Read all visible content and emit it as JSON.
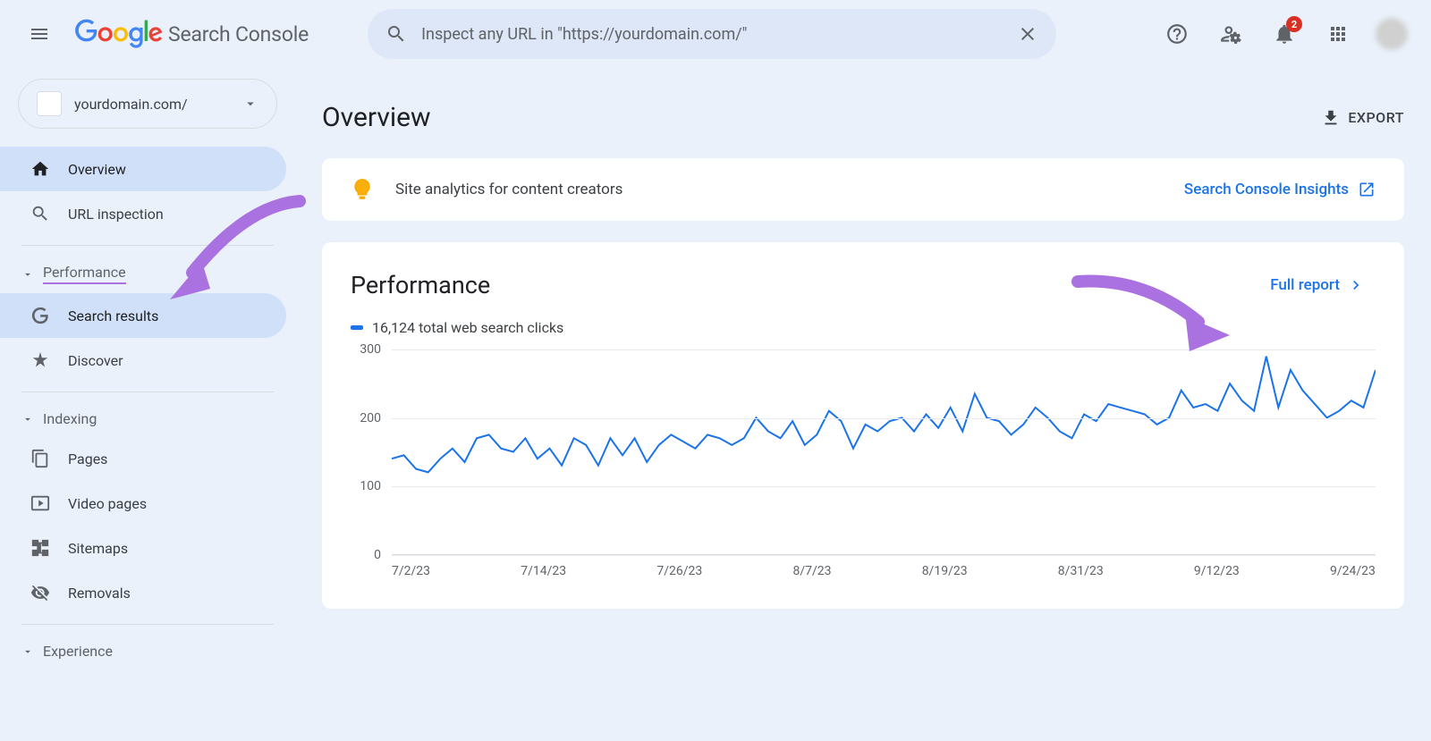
{
  "app": {
    "title": "Search Console"
  },
  "search": {
    "placeholder": "Inspect any URL in \"https://yourdomain.com/\""
  },
  "notifications": {
    "count": "2"
  },
  "property": {
    "domain": "yourdomain.com/"
  },
  "sidebar": {
    "overview": "Overview",
    "url_inspection": "URL inspection",
    "group_performance": "Performance",
    "search_results": "Search results",
    "discover": "Discover",
    "group_indexing": "Indexing",
    "pages": "Pages",
    "video_pages": "Video pages",
    "sitemaps": "Sitemaps",
    "removals": "Removals",
    "group_experience": "Experience"
  },
  "main": {
    "title": "Overview",
    "export": "EXPORT",
    "insights_text": "Site analytics for content creators",
    "insights_link": "Search Console Insights",
    "perf_title": "Performance",
    "full_report": "Full report",
    "legend_label": "16,124 total web search clicks"
  },
  "chart_data": {
    "type": "line",
    "title": "Performance",
    "ylabel": "clicks",
    "ylim": [
      0,
      300
    ],
    "y_ticks": [
      0,
      100,
      200,
      300
    ],
    "x_ticks": [
      "7/2/23",
      "7/14/23",
      "7/26/23",
      "8/7/23",
      "8/19/23",
      "8/31/23",
      "9/12/23",
      "9/24/23"
    ],
    "series": [
      {
        "name": "Web search clicks",
        "values": [
          140,
          145,
          125,
          120,
          140,
          155,
          135,
          170,
          175,
          155,
          150,
          170,
          140,
          155,
          130,
          170,
          160,
          130,
          170,
          145,
          170,
          135,
          160,
          175,
          165,
          155,
          175,
          170,
          160,
          170,
          200,
          180,
          170,
          195,
          160,
          175,
          210,
          195,
          155,
          190,
          180,
          195,
          200,
          180,
          205,
          185,
          215,
          180,
          235,
          200,
          195,
          175,
          190,
          215,
          200,
          180,
          170,
          205,
          195,
          220,
          215,
          210,
          205,
          190,
          200,
          240,
          215,
          220,
          210,
          250,
          225,
          210,
          290,
          215,
          270,
          240,
          220,
          200,
          210,
          225,
          215,
          270
        ]
      }
    ]
  }
}
